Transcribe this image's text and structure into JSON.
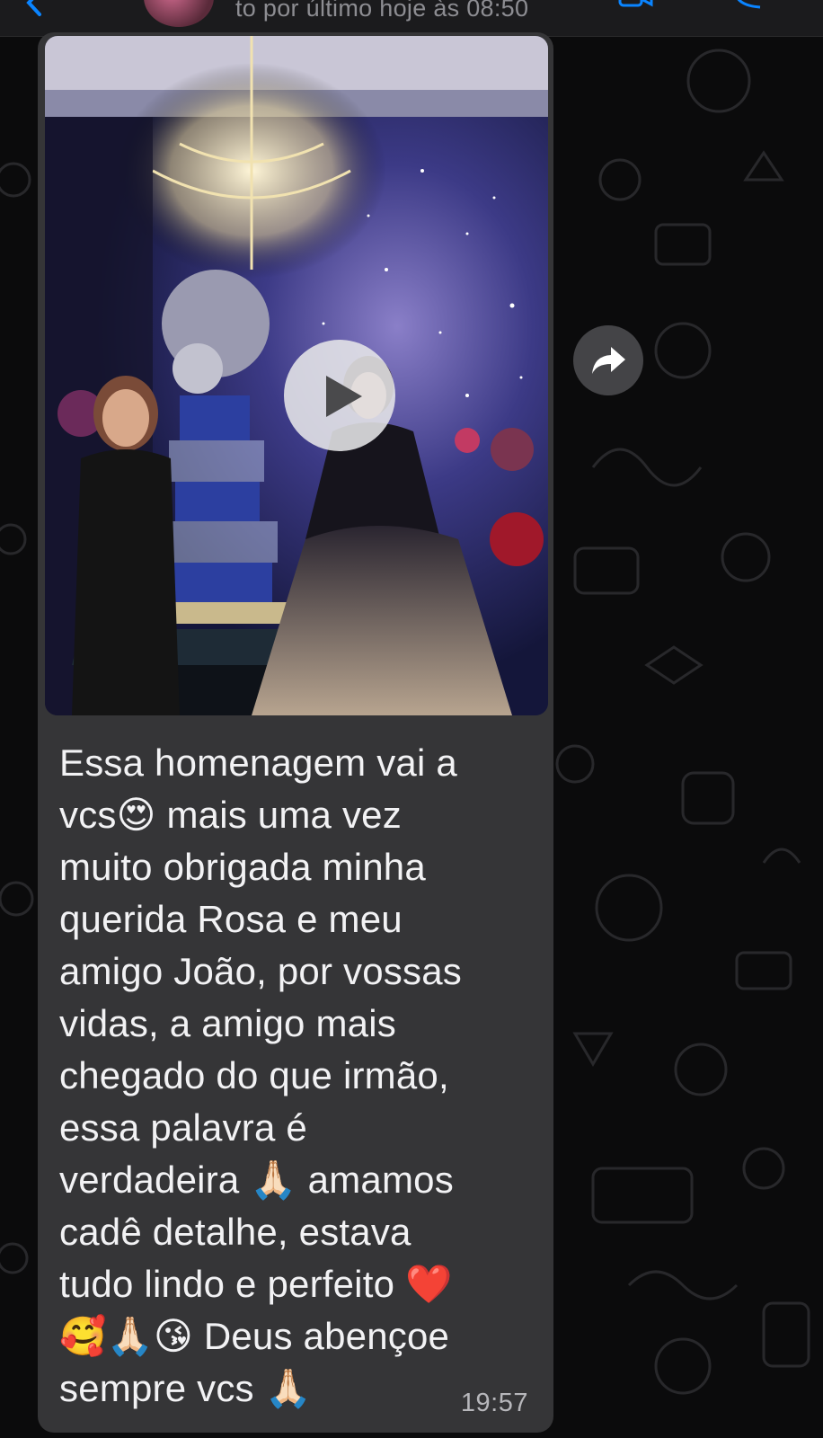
{
  "header": {
    "last_seen": "to por último hoje às 08:50"
  },
  "message": {
    "text": "Essa homenagem vai a vcs😍 mais uma vez muito obrigada minha querida Rosa e meu amigo João, por vossas vidas, a amigo mais chegado do que irmão, essa palavra é verdadeira 🙏🏻 amamos cadê detalhe, estava tudo lindo e perfeito ❤️🥰🙏🏻😘 Deus abençoe sempre vcs 🙏🏻",
    "text_lines": [
      "Essa homenagem vai a",
      "vcs😍 mais uma vez",
      "muito obrigada minha",
      "querida Rosa e meu",
      "amigo João, por vossas",
      "vidas, a amigo mais",
      "chegado do que irmão,",
      "essa palavra é",
      "verdadeira 🙏🏻 amamos",
      "cadê detalhe, estava",
      "tudo lindo e perfeito ❤️",
      "🥰🙏🏻😘 Deus abençoe",
      "sempre vcs 🙏🏻"
    ],
    "time": "19:57",
    "media_type": "video"
  },
  "icons": {
    "play": "play-icon",
    "forward": "forward-arrow-icon",
    "back": "chevron-left-icon",
    "video_call": "video-camera-icon",
    "call": "phone-icon"
  },
  "colors": {
    "wallpaper": "#0b0b0c",
    "bubble": "#353537",
    "text": "#f2f2f4",
    "timestamp": "#b7b7bb",
    "accent": "#0a84ff"
  }
}
